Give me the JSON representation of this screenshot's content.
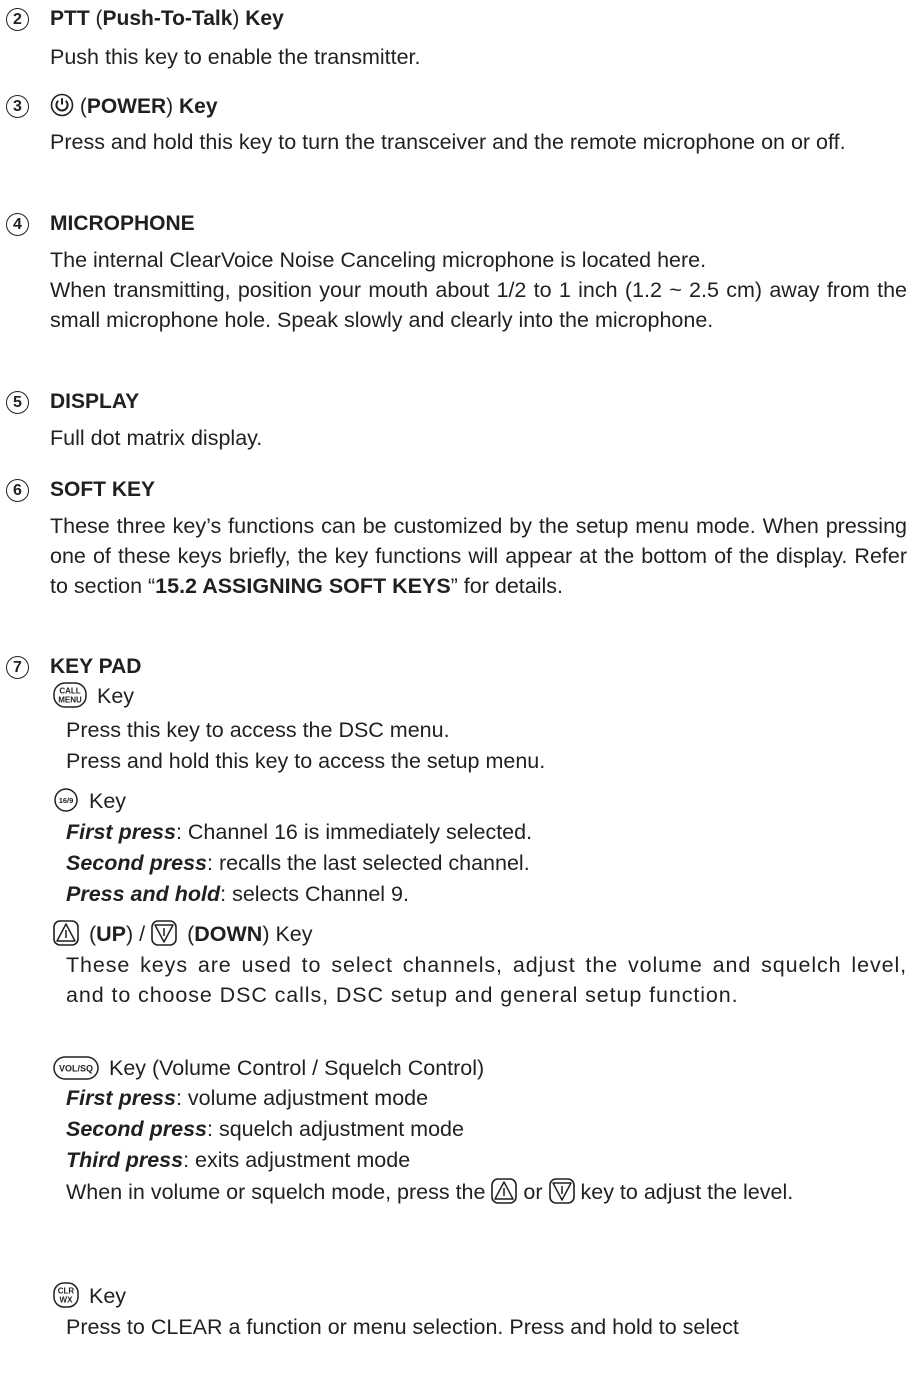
{
  "sections": [
    {
      "num": "2",
      "title_a": "PTT",
      "title_b": " (",
      "title_c": "Push-To-Talk",
      "title_d": ") ",
      "title_e": "Key",
      "body": "Push this key to enable the transmitter."
    },
    {
      "num": "3",
      "title_a": " (",
      "title_b": "POWER",
      "title_c": ") ",
      "title_d": "Key",
      "body": "Press and hold this key to turn the transceiver and the remote microphone on or off."
    },
    {
      "num": "4",
      "title": "MICROPHONE",
      "body1": "The internal ClearVoice Noise Canceling microphone is located here.",
      "body2": "When transmitting, position your mouth about 1/2 to 1 inch (1.2 ~ 2.5 cm) away from the small microphone hole. Speak slowly and clearly into the microphone."
    },
    {
      "num": "5",
      "title": "DISPLAY",
      "body": "Full dot matrix display."
    },
    {
      "num": "6",
      "title": "SOFT KEY",
      "body_a": "These three key’s functions can be customized by the setup menu mode. When pressing one of these keys briefly, the key functions will appear at the bottom of the display. Refer to section “",
      "body_b": "15.2 ASSIGNING SOFT KEYS",
      "body_c": "” for details."
    },
    {
      "num": "7",
      "title": "KEY PAD"
    }
  ],
  "keys": {
    "call": {
      "icon_text_1": "CALL",
      "icon_text_2": "MENU",
      "label": " Key",
      "line1": "Press this key to access the DSC menu.",
      "line2": "Press and hold this key to access the setup menu."
    },
    "ch16": {
      "icon_text": "16/9",
      "label": " Key",
      "l1_em": "First press",
      "l1": ": Channel 16 is immediately selected.",
      "l2_em": "Second press",
      "l2": ": recalls the last selected channel.",
      "l3_em": "Press and hold",
      "l3": ": selects Channel 9."
    },
    "updown": {
      "a": " (",
      "up": "UP",
      "b": ") / ",
      "c": " (",
      "down": "DOWN",
      "d": ") Key",
      "body": "These keys are used to select channels, adjust the volume and squelch level, and to choose DSC calls, DSC setup and general setup function."
    },
    "volsq": {
      "icon_text": "VOL/SQ",
      "label": " Key (Volume Control / Squelch Control)",
      "l1_em": "First press",
      "l1": ": volume adjustment mode",
      "l2_em": "Second press",
      "l2": ": squelch adjustment mode",
      "l3_em": "Third press",
      "l3": ": exits adjustment mode",
      "l4a": "When in volume or squelch mode, press the ",
      "l4b": " or ",
      "l4c": " key to adjust the level."
    },
    "clr": {
      "icon_text_1": "CLR",
      "icon_text_2": "WX",
      "label": " Key",
      "line1": "Press to CLEAR a function or menu selection. Press and hold to select"
    }
  }
}
